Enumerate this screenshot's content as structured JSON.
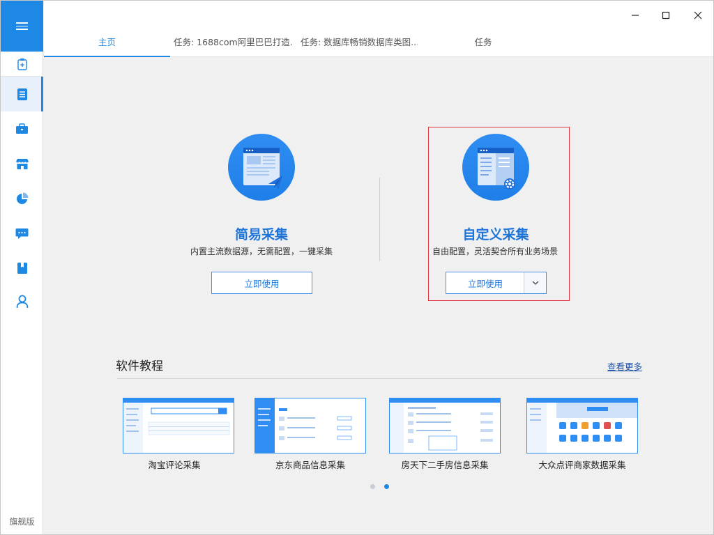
{
  "sidebar": {
    "items": [
      {
        "icon": "clipboard-plus-icon"
      },
      {
        "icon": "document-list-icon"
      },
      {
        "icon": "briefcase-icon"
      },
      {
        "icon": "store-icon"
      },
      {
        "icon": "pie-chart-icon"
      },
      {
        "icon": "chat-bubble-icon"
      },
      {
        "icon": "book-icon"
      },
      {
        "icon": "user-icon"
      }
    ],
    "edition_label": "旗舰版"
  },
  "tabs": [
    {
      "label": "主页"
    },
    {
      "label": "任务: 1688com阿里巴巴打造..."
    },
    {
      "label": "任务: 数据库畅销数据库类图..."
    },
    {
      "label": "任务"
    }
  ],
  "simple": {
    "title": "简易采集",
    "subtitle": "内置主流数据源，无需配置，一键采集",
    "button": "立即使用"
  },
  "custom": {
    "title": "自定义采集",
    "subtitle": "自由配置，灵活契合所有业务场景",
    "button": "立即使用"
  },
  "tutorials": {
    "title": "软件教程",
    "more": "查看更多",
    "items": [
      {
        "label": "淘宝评论采集"
      },
      {
        "label": "京东商品信息采集"
      },
      {
        "label": "房天下二手房信息采集"
      },
      {
        "label": "大众点评商家数据采集"
      }
    ]
  },
  "colors": {
    "accent": "#1e88e5",
    "highlight_border": "#e0383e"
  }
}
